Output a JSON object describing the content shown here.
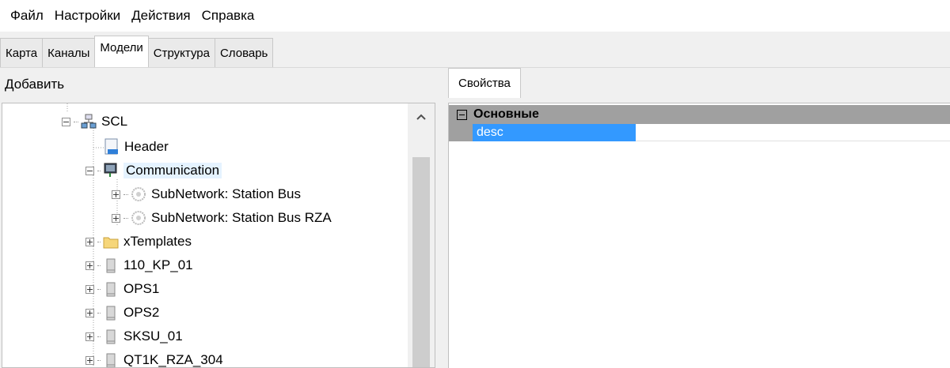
{
  "menu": [
    "Файл",
    "Настройки",
    "Действия",
    "Справка"
  ],
  "tabs": [
    {
      "label": "Карта",
      "active": false
    },
    {
      "label": "Каналы",
      "active": false
    },
    {
      "label": "Модели",
      "active": true
    },
    {
      "label": "Структура",
      "active": false
    },
    {
      "label": "Словарь",
      "active": false
    }
  ],
  "left": {
    "header": "Добавить",
    "tree": [
      {
        "label": "SCL",
        "icon": "network-icon",
        "expander": "minus"
      },
      {
        "label": "Header",
        "icon": "document-icon",
        "expander": "none"
      },
      {
        "label": "Communication",
        "icon": "computer-icon",
        "expander": "minus"
      },
      {
        "label": "SubNetwork: Station Bus",
        "icon": "globe-icon",
        "expander": "plus"
      },
      {
        "label": "SubNetwork: Station Bus RZA",
        "icon": "globe-icon",
        "expander": "plus"
      },
      {
        "label": "xTemplates",
        "icon": "folder-icon",
        "expander": "plus"
      },
      {
        "label": "110_KP_01",
        "icon": "server-icon",
        "expander": "plus"
      },
      {
        "label": "OPS1",
        "icon": "server-icon",
        "expander": "plus"
      },
      {
        "label": "OPS2",
        "icon": "server-icon",
        "expander": "plus"
      },
      {
        "label": "SKSU_01",
        "icon": "server-icon",
        "expander": "plus"
      },
      {
        "label": "QT1K_RZA_304",
        "icon": "server-icon",
        "expander": "plus"
      }
    ]
  },
  "right": {
    "tab": "Свойства",
    "category": "Основные",
    "property": {
      "name": "desc",
      "value": ""
    }
  },
  "colors": {
    "selection": "#3399ff",
    "category_bg": "#a0a0a0"
  }
}
